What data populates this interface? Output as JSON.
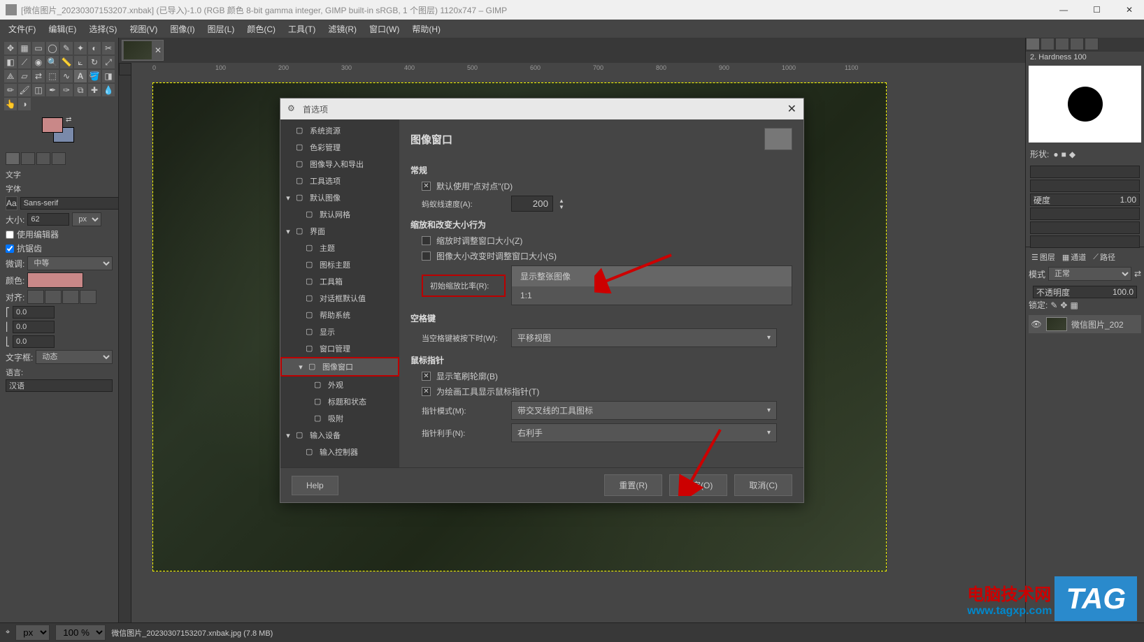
{
  "window": {
    "title": "[微信图片_20230307153207.xnbak] (已导入)-1.0 (RGB 颜色 8-bit gamma integer, GIMP built-in sRGB, 1 个图层) 1120x747 – GIMP"
  },
  "menubar": [
    "文件(F)",
    "编辑(E)",
    "选择(S)",
    "视图(V)",
    "图像(I)",
    "图层(L)",
    "颜色(C)",
    "工具(T)",
    "滤镜(R)",
    "窗口(W)",
    "帮助(H)"
  ],
  "tool_options": {
    "heading": "文字",
    "font_label": "字体",
    "font_value": "Sans-serif",
    "size_label": "大小:",
    "size_value": "62",
    "size_unit": "px",
    "use_editor": "使用编辑器",
    "antialias": "抗锯齿",
    "hinting_label": "微调:",
    "hinting_value": "中等",
    "color_label": "颜色:",
    "justify_label": "对齐:",
    "indent1": "0.0",
    "indent2": "0.0",
    "indent3": "0.0",
    "textdir_label": "文字框:",
    "textdir_value": "动态",
    "lang_label": "语言:",
    "lang_value": "汉语"
  },
  "ruler_ticks": [
    "0",
    "100",
    "200",
    "300",
    "400",
    "500",
    "600",
    "700",
    "800",
    "900",
    "1000",
    "1100"
  ],
  "right_panel": {
    "brush_name": "2. Hardness 100",
    "shape_label": "形状:",
    "hardness_label": "硬度",
    "hardness_value": "1.00",
    "layers_tab": "图层",
    "channels_tab": "通道",
    "paths_tab": "路径",
    "mode_label": "模式",
    "mode_value": "正常",
    "opacity_label": "不透明度",
    "opacity_value": "100.0",
    "lock_label": "锁定:",
    "layer_name": "微信图片_202"
  },
  "status": {
    "unit": "px",
    "zoom": "100 %",
    "filename": "微信图片_20230307153207.xnbak.jpg (7.8 MB)"
  },
  "dialog": {
    "title": "首选项",
    "tree": [
      {
        "label": "系统资源",
        "lvl": 1
      },
      {
        "label": "色彩管理",
        "lvl": 1
      },
      {
        "label": "图像导入和导出",
        "lvl": 1
      },
      {
        "label": "工具选项",
        "lvl": 1
      },
      {
        "label": "默认图像",
        "lvl": 1,
        "exp": true
      },
      {
        "label": "默认网格",
        "lvl": 2
      },
      {
        "label": "界面",
        "lvl": 1,
        "exp": true
      },
      {
        "label": "主题",
        "lvl": 2
      },
      {
        "label": "图标主题",
        "lvl": 2
      },
      {
        "label": "工具箱",
        "lvl": 2
      },
      {
        "label": "对话框默认值",
        "lvl": 2
      },
      {
        "label": "帮助系统",
        "lvl": 2
      },
      {
        "label": "显示",
        "lvl": 2
      },
      {
        "label": "窗口管理",
        "lvl": 2
      },
      {
        "label": "图像窗口",
        "lvl": 2,
        "selected": true,
        "exp": true
      },
      {
        "label": "外观",
        "lvl": 3
      },
      {
        "label": "标题和状态",
        "lvl": 3
      },
      {
        "label": "吸附",
        "lvl": 3
      },
      {
        "label": "输入设备",
        "lvl": 1,
        "exp": true
      },
      {
        "label": "输入控制器",
        "lvl": 2
      }
    ],
    "content": {
      "title": "图像窗口",
      "section_general": "常规",
      "dot_for_dot": "默认使用\"点对点\"(D)",
      "ant_speed_label": "蚂蚁线速度(A):",
      "ant_speed_value": "200",
      "section_zoom": "缩放和改变大小行为",
      "zoom_resize": "缩放时调整窗口大小(Z)",
      "size_resize": "图像大小改变时调整窗口大小(S)",
      "initial_zoom_label": "初始缩放比率(R):",
      "initial_zoom_options": [
        "显示整张图像",
        "1:1"
      ],
      "section_spacebar": "空格键",
      "spacebar_label": "当空格键被按下时(W):",
      "spacebar_value": "平移视图",
      "section_pointer": "鼠标指针",
      "show_brush": "显示笔刷轮廓(B)",
      "show_pointer": "为绘画工具显示鼠标指针(T)",
      "pointer_mode_label": "指针模式(M):",
      "pointer_mode_value": "带交叉线的工具图标",
      "pointer_hand_label": "指针利手(N):",
      "pointer_hand_value": "右利手"
    },
    "buttons": {
      "help": "Help",
      "reset": "重置(R)",
      "ok": "确定(O)",
      "cancel": "取消(C)"
    }
  },
  "watermark": {
    "text": "电脑技术网",
    "url": "www.tagxp.com",
    "tag": "TAG"
  }
}
